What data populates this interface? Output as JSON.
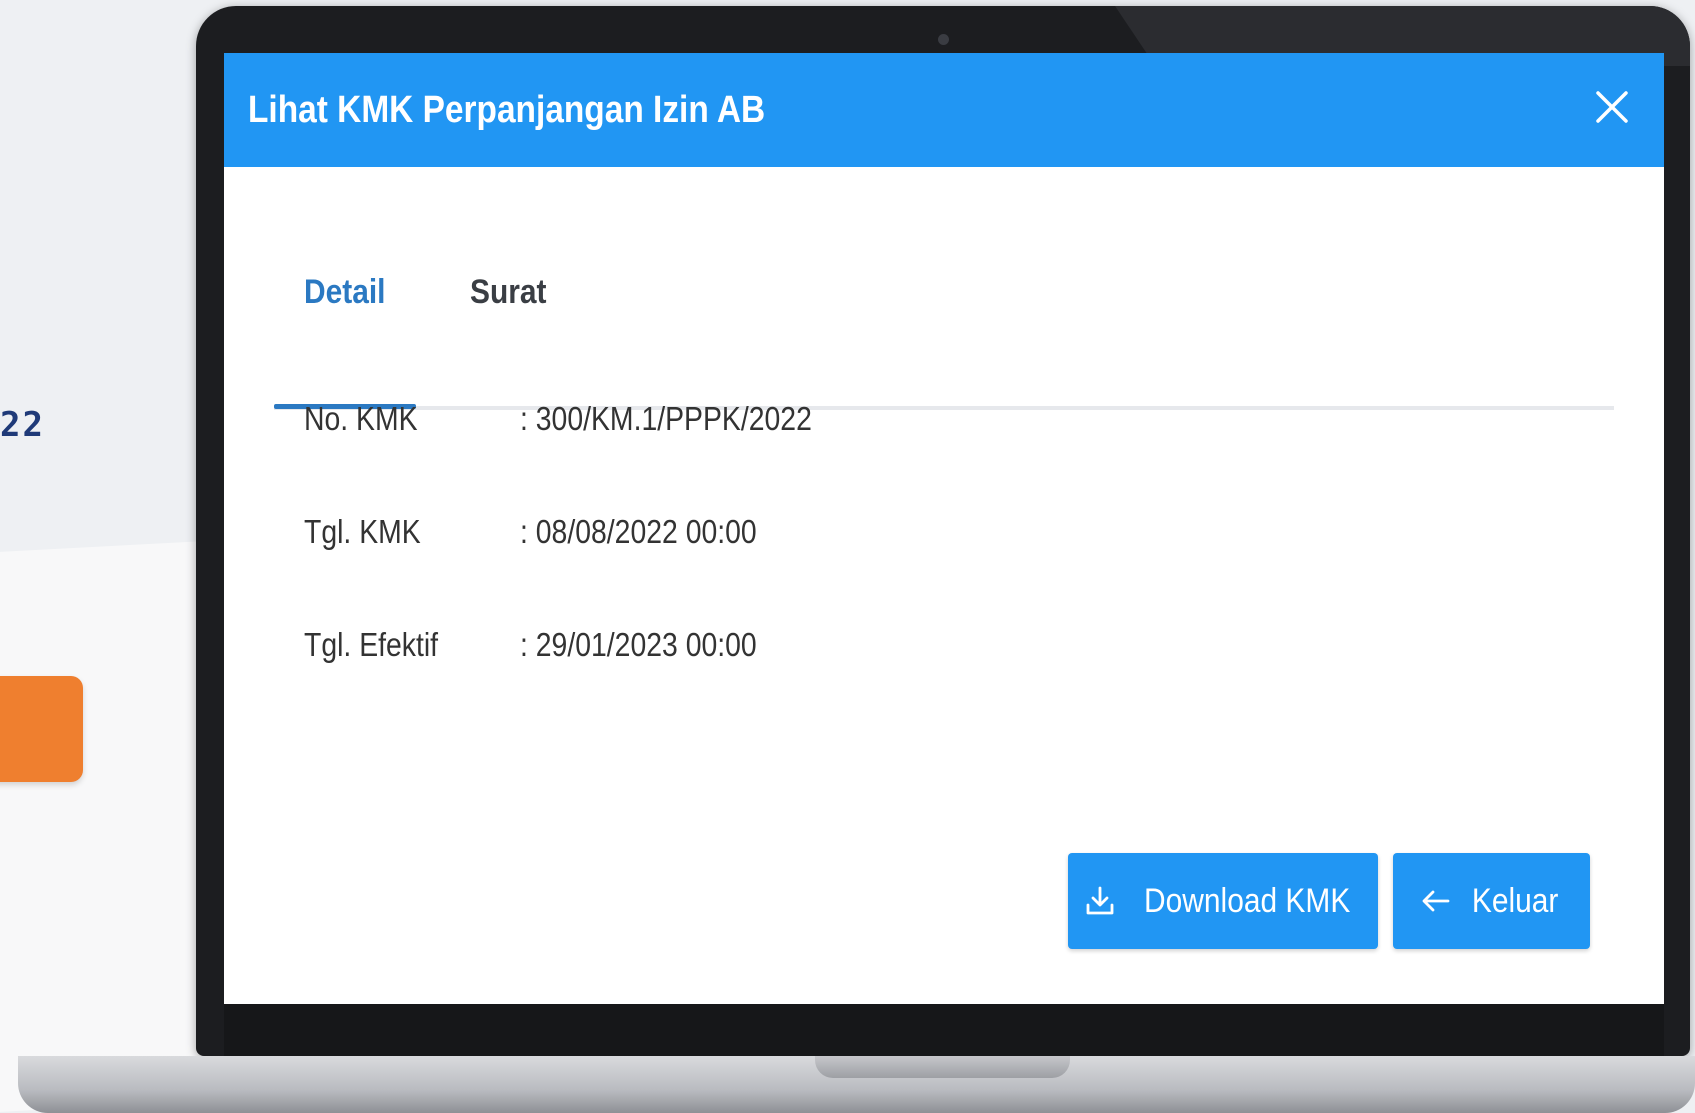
{
  "background": {
    "partial_text": "22"
  },
  "modal": {
    "title": "Lihat KMK Perpanjangan Izin AB",
    "close_symbol": "✕",
    "tabs": [
      {
        "label": "Detail",
        "active": true
      },
      {
        "label": "Surat",
        "active": false
      }
    ],
    "fields": [
      {
        "label": "No. KMK",
        "value": ": 300/KM.1/PPPK/2022"
      },
      {
        "label": "Tgl. KMK",
        "value": ": 08/08/2022 00:00"
      },
      {
        "label": "Tgl. Efektif",
        "value": ": 29/01/2023 00:00"
      }
    ],
    "buttons": {
      "download_label": "Download KMK",
      "download_icon": "download-icon",
      "exit_label": "Keluar",
      "exit_icon": "arrow-left-icon"
    }
  },
  "colors": {
    "header": "#2196f3",
    "tab_active": "#2b79c2",
    "button": "#2196f3",
    "accent_orange": "#ef7f2f"
  }
}
